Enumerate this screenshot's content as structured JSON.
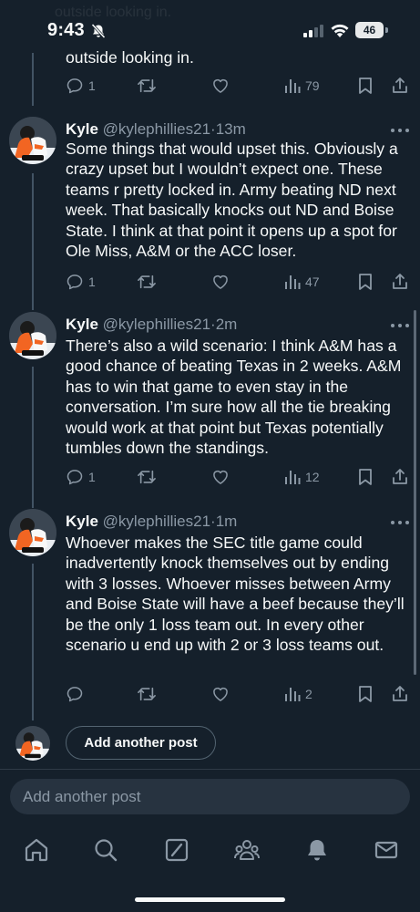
{
  "status_bar": {
    "time": "9:43",
    "battery": "46"
  },
  "background_text": "outside looking in.",
  "prev_post": {
    "text_tail": "outside looking in.",
    "replies": "1",
    "reposts": "",
    "likes": "",
    "views": "79"
  },
  "posts": [
    {
      "name": "Kyle",
      "handle": "@kylephillies21",
      "sep": "·",
      "time": "13m",
      "text": "Some things that would upset this. Obviously a crazy upset but I wouldn’t expect one. These teams r pretty locked in. Army beating ND next week. That basically knocks out ND and Boise State. I think at that point it opens up a spot for Ole Miss, A&M or the ACC loser.",
      "replies": "1",
      "views": "47"
    },
    {
      "name": "Kyle",
      "handle": "@kylephillies21",
      "sep": "·",
      "time": "2m",
      "text": "There’s also a wild scenario: I think A&M has a good chance of beating Texas in 2 weeks. A&M has to win that game to even stay in the conversation. I’m sure how all the tie breaking would work at that point but Texas potentially tumbles down the standings.",
      "replies": "1",
      "views": "12"
    },
    {
      "name": "Kyle",
      "handle": "@kylephillies21",
      "sep": "·",
      "time": "1m",
      "text": "Whoever makes the SEC title game could inadvertently knock themselves out by ending with 3 losses. Whoever misses between Army and Boise State will have a beef because they’ll be the only 1 loss team out. In every other scenario u end up with 2 or 3 loss teams out.",
      "replies": "",
      "views": "2"
    }
  ],
  "add_another_label": "Add another post",
  "compose_placeholder": "Add another post",
  "tabs": [
    "home-icon",
    "search-icon",
    "grok-icon",
    "communities-icon",
    "notifications-icon",
    "messages-icon"
  ],
  "colors": {
    "background": "#15202b",
    "text": "#f7f9f9",
    "muted": "#8b98a5",
    "thread_line": "#425364"
  }
}
